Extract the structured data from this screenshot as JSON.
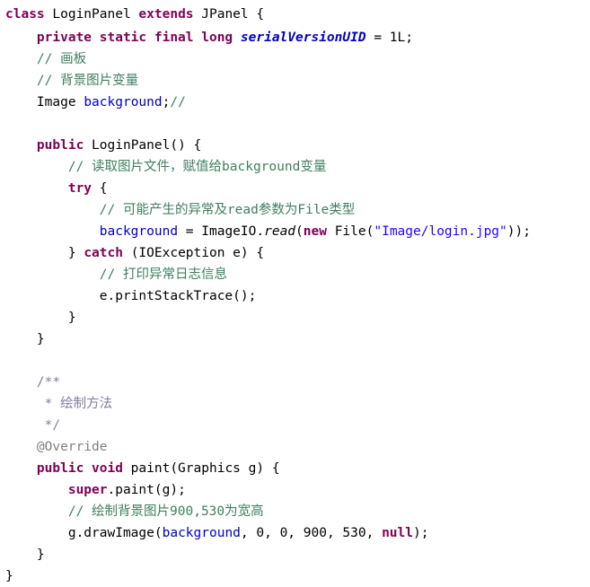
{
  "editor": {
    "language": "Java",
    "class_name": "LoginPanel",
    "background_color": "#ffffff",
    "colors": {
      "keyword": "#7F0055",
      "static_field": "#0000C0",
      "variable": "#0000C0",
      "string": "#2A00FF",
      "comment": "#3F7F5F",
      "javadoc": "#7F7F9F",
      "annotation": "#808080",
      "plain": "#000000"
    }
  },
  "code": {
    "lines": [
      {
        "n": 1,
        "indent": "",
        "text": "class LoginPanel extends JPanel {",
        "tokens": [
          {
            "t": "class",
            "k": "kw"
          },
          {
            "t": " LoginPanel ",
            "k": "plain"
          },
          {
            "t": "extends",
            "k": "kw"
          },
          {
            "t": " JPanel {",
            "k": "plain"
          }
        ]
      },
      {
        "n": 2,
        "indent": "    ",
        "text": "    private static final long serialVersionUID = 1L;",
        "tokens": [
          {
            "t": "    ",
            "k": "plain"
          },
          {
            "t": "private static final long",
            "k": "kw"
          },
          {
            "t": " ",
            "k": "plain"
          },
          {
            "t": "serialVersionUID",
            "k": "field"
          },
          {
            "t": " = 1L;",
            "k": "plain"
          }
        ]
      },
      {
        "n": 3,
        "indent": "    ",
        "text": "    // 画板",
        "tokens": [
          {
            "t": "    ",
            "k": "plain"
          },
          {
            "t": "// 画板",
            "k": "comment"
          }
        ]
      },
      {
        "n": 4,
        "indent": "    ",
        "text": "    // 背景图片变量",
        "tokens": [
          {
            "t": "    ",
            "k": "plain"
          },
          {
            "t": "// 背景图片变量",
            "k": "comment"
          }
        ]
      },
      {
        "n": 5,
        "indent": "    ",
        "text": "    Image background;//",
        "tokens": [
          {
            "t": "    Image ",
            "k": "plain"
          },
          {
            "t": "background",
            "k": "var"
          },
          {
            "t": ";",
            "k": "plain"
          },
          {
            "t": "//",
            "k": "comment"
          }
        ]
      },
      {
        "n": 6,
        "indent": "",
        "text": "",
        "tokens": []
      },
      {
        "n": 7,
        "indent": "    ",
        "text": "    public LoginPanel() {",
        "tokens": [
          {
            "t": "    ",
            "k": "plain"
          },
          {
            "t": "public",
            "k": "kw"
          },
          {
            "t": " LoginPanel() {",
            "k": "plain"
          }
        ]
      },
      {
        "n": 8,
        "indent": "        ",
        "text": "        // 读取图片文件，赋值给background变量",
        "tokens": [
          {
            "t": "        ",
            "k": "plain"
          },
          {
            "t": "// 读取图片文件，赋值给background变量",
            "k": "comment"
          }
        ]
      },
      {
        "n": 9,
        "indent": "        ",
        "text": "        try {",
        "tokens": [
          {
            "t": "        ",
            "k": "plain"
          },
          {
            "t": "try",
            "k": "kw"
          },
          {
            "t": " {",
            "k": "plain"
          }
        ]
      },
      {
        "n": 10,
        "indent": "            ",
        "text": "            // 可能产生的异常及read参数为File类型",
        "tokens": [
          {
            "t": "            ",
            "k": "plain"
          },
          {
            "t": "// 可能产生的异常及read参数为File类型",
            "k": "comment"
          }
        ]
      },
      {
        "n": 11,
        "indent": "            ",
        "text": "            background = ImageIO.read(new File(\"Image/login.jpg\"));",
        "tokens": [
          {
            "t": "            ",
            "k": "plain"
          },
          {
            "t": "background",
            "k": "var"
          },
          {
            "t": " = ImageIO.",
            "k": "plain"
          },
          {
            "t": "read",
            "k": "method"
          },
          {
            "t": "(",
            "k": "plain"
          },
          {
            "t": "new",
            "k": "kw"
          },
          {
            "t": " File(",
            "k": "plain"
          },
          {
            "t": "\"Image/login.jpg\"",
            "k": "str"
          },
          {
            "t": "));",
            "k": "plain"
          }
        ]
      },
      {
        "n": 12,
        "indent": "        ",
        "text": "        } catch (IOException e) {",
        "tokens": [
          {
            "t": "        } ",
            "k": "plain"
          },
          {
            "t": "catch",
            "k": "kw"
          },
          {
            "t": " (IOException e) {",
            "k": "plain"
          }
        ]
      },
      {
        "n": 13,
        "indent": "            ",
        "text": "            // 打印异常日志信息",
        "tokens": [
          {
            "t": "            ",
            "k": "plain"
          },
          {
            "t": "// 打印异常日志信息",
            "k": "comment"
          }
        ]
      },
      {
        "n": 14,
        "indent": "            ",
        "text": "            e.printStackTrace();",
        "tokens": [
          {
            "t": "            e.printStackTrace();",
            "k": "plain"
          }
        ]
      },
      {
        "n": 15,
        "indent": "        ",
        "text": "        }",
        "tokens": [
          {
            "t": "        }",
            "k": "plain"
          }
        ]
      },
      {
        "n": 16,
        "indent": "    ",
        "text": "    }",
        "tokens": [
          {
            "t": "    }",
            "k": "plain"
          }
        ]
      },
      {
        "n": 17,
        "indent": "",
        "text": "",
        "tokens": []
      },
      {
        "n": 18,
        "indent": "    ",
        "text": "    /**",
        "tokens": [
          {
            "t": "    ",
            "k": "plain"
          },
          {
            "t": "/**",
            "k": "javadoc"
          }
        ]
      },
      {
        "n": 19,
        "indent": "     ",
        "text": "     * 绘制方法",
        "tokens": [
          {
            "t": "     ",
            "k": "plain"
          },
          {
            "t": "* 绘制方法",
            "k": "javadoc"
          }
        ]
      },
      {
        "n": 20,
        "indent": "     ",
        "text": "     */",
        "tokens": [
          {
            "t": "     ",
            "k": "plain"
          },
          {
            "t": "*/",
            "k": "javadoc"
          }
        ]
      },
      {
        "n": 21,
        "indent": "    ",
        "text": "    @Override",
        "tokens": [
          {
            "t": "    ",
            "k": "plain"
          },
          {
            "t": "@Override",
            "k": "annot"
          }
        ]
      },
      {
        "n": 22,
        "indent": "    ",
        "text": "    public void paint(Graphics g) {",
        "tokens": [
          {
            "t": "    ",
            "k": "plain"
          },
          {
            "t": "public void",
            "k": "kw"
          },
          {
            "t": " paint(Graphics g) {",
            "k": "plain"
          }
        ]
      },
      {
        "n": 23,
        "indent": "        ",
        "text": "        super.paint(g);",
        "tokens": [
          {
            "t": "        ",
            "k": "plain"
          },
          {
            "t": "super",
            "k": "kw"
          },
          {
            "t": ".paint(g);",
            "k": "plain"
          }
        ]
      },
      {
        "n": 24,
        "indent": "        ",
        "text": "        // 绘制背景图片900,530为宽高",
        "tokens": [
          {
            "t": "        ",
            "k": "plain"
          },
          {
            "t": "// 绘制背景图片900,530为宽高",
            "k": "comment"
          }
        ]
      },
      {
        "n": 25,
        "indent": "        ",
        "text": "        g.drawImage(background, 0, 0, 900, 530, null);",
        "tokens": [
          {
            "t": "        g.drawImage(",
            "k": "plain"
          },
          {
            "t": "background",
            "k": "var"
          },
          {
            "t": ", 0, 0, 900, 530, ",
            "k": "plain"
          },
          {
            "t": "null",
            "k": "kw"
          },
          {
            "t": ");",
            "k": "plain"
          }
        ]
      },
      {
        "n": 26,
        "indent": "    ",
        "text": "    }",
        "tokens": [
          {
            "t": "    }",
            "k": "plain"
          }
        ]
      },
      {
        "n": 27,
        "indent": "",
        "text": "}",
        "tokens": [
          {
            "t": "}",
            "k": "plain"
          }
        ]
      }
    ]
  }
}
